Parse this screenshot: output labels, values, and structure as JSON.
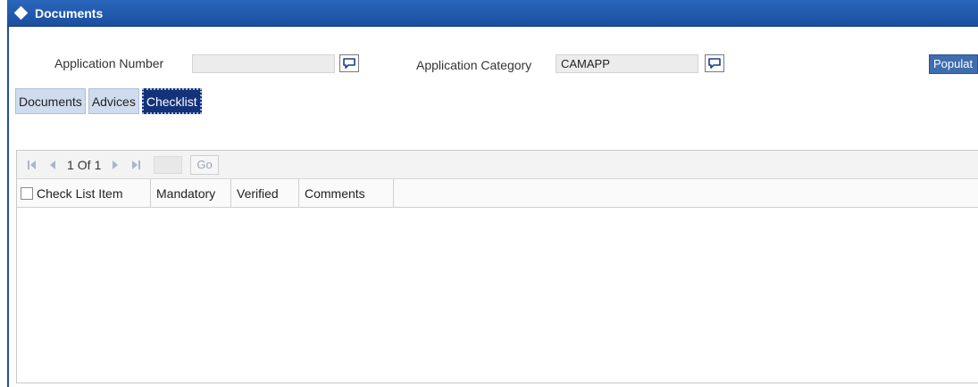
{
  "window": {
    "title": "Documents"
  },
  "header_fields": {
    "application_number": {
      "label": "Application Number",
      "value": ""
    },
    "application_category": {
      "label": "Application Category",
      "value": "CAMAPP"
    },
    "populate_label": "Populat"
  },
  "tabs": [
    {
      "label": "Documents",
      "active": false
    },
    {
      "label": "Advices",
      "active": false
    },
    {
      "label": "Checklist",
      "active": true
    }
  ],
  "pager": {
    "current": "1",
    "of_label": "Of",
    "total": "1",
    "go_label": "Go"
  },
  "grid": {
    "columns": [
      "Check List Item",
      "Mandatory",
      "Verified",
      "Comments"
    ]
  },
  "colors": {
    "title_bar": "#1f57ab",
    "active_tab": "#14327a",
    "tab": "#cfdcee",
    "populate": "#3f6dae"
  }
}
